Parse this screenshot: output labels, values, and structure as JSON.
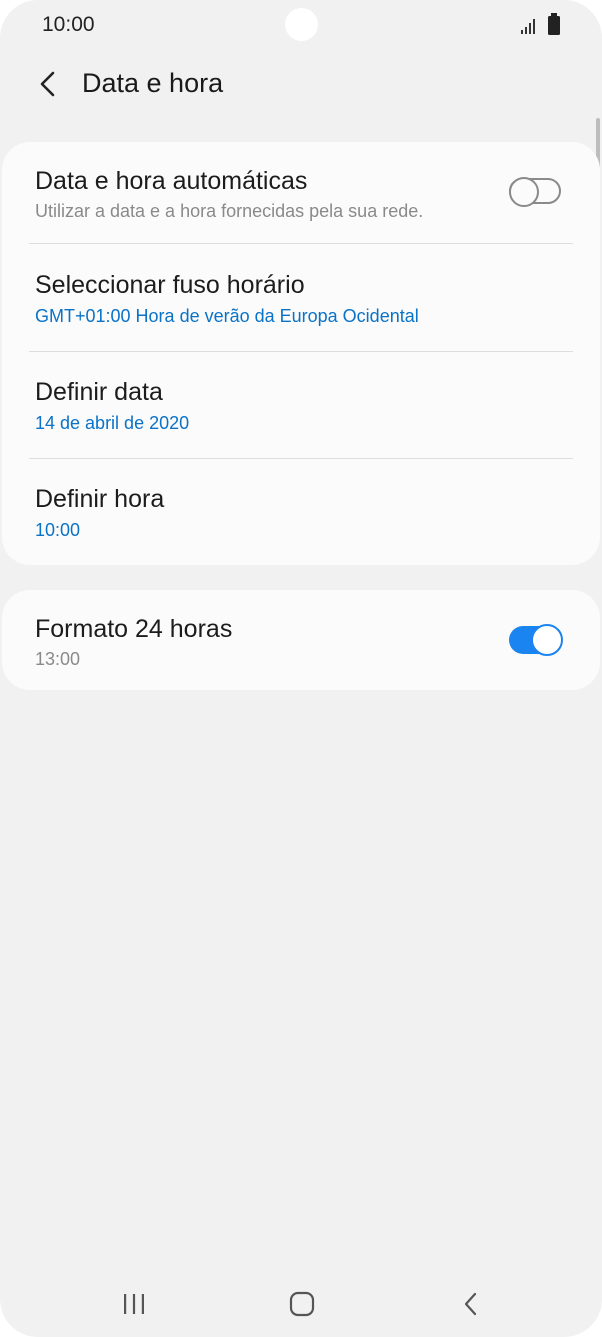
{
  "status_bar": {
    "time": "10:00"
  },
  "header": {
    "title": "Data e hora",
    "back_icon": "chevron-left-icon"
  },
  "settings_group_1": [
    {
      "title": "Data e hora automáticas",
      "subtitle": "Utilizar a data e a hora fornecidas pela sua rede.",
      "toggle": false
    },
    {
      "title": "Seleccionar fuso horário",
      "subtitle": "GMT+01:00 Hora de verão da Europa Ocidental"
    },
    {
      "title": "Definir data",
      "subtitle": "14 de abril de 2020"
    },
    {
      "title": "Definir hora",
      "subtitle": "10:00"
    }
  ],
  "settings_group_2": [
    {
      "title": "Formato 24 horas",
      "subtitle": "13:00",
      "toggle": true
    }
  ],
  "nav_bar": {
    "recent_icon": "recent-apps-icon",
    "home_icon": "home-icon",
    "back_icon": "back-icon"
  },
  "colors": {
    "accent": "#1a84f0",
    "link_text": "#0a72c7",
    "background": "#f1f1f1",
    "card": "#fbfbfb"
  }
}
